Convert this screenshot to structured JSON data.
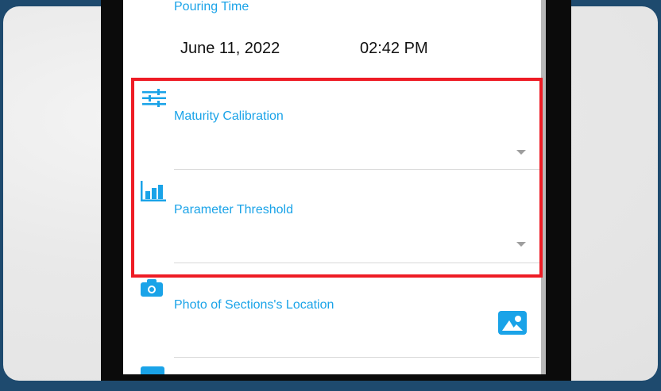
{
  "pouring": {
    "label": "Pouring Time",
    "date": "June 11, 2022",
    "time": "02:42 PM"
  },
  "maturity": {
    "label": "Maturity Calibration",
    "icon": "sliders-icon"
  },
  "threshold": {
    "label": "Parameter Threshold",
    "icon": "bar-chart-icon"
  },
  "photo": {
    "label": "Photo of Sections's Location",
    "icon": "camera-icon",
    "action_icon": "image-icon"
  },
  "colors": {
    "accent": "#1aa3e8",
    "highlight": "#ee1c25",
    "band": "#1e4a6e"
  }
}
